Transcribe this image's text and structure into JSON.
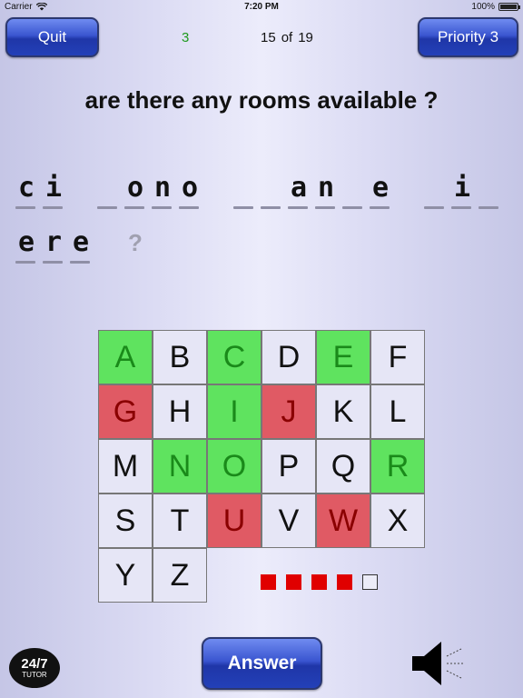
{
  "status_bar": {
    "carrier": "Carrier",
    "time": "7:20 PM",
    "battery": "100%",
    "battery_level": 1.0
  },
  "toolbar": {
    "quit_label": "Quit",
    "priority_label": "Priority 3"
  },
  "score": "3",
  "progress": {
    "current": "15",
    "of": "of",
    "total": "19"
  },
  "question": "are there any rooms available ?",
  "puzzle": {
    "lines": [
      [
        "c",
        "i",
        " ",
        "",
        "o",
        "n",
        "o",
        " ",
        "",
        "",
        "a",
        "n",
        "",
        "e",
        " ",
        "",
        "i",
        ""
      ],
      [
        "e",
        "r",
        "e"
      ]
    ],
    "end_mark": "?"
  },
  "letters": [
    {
      "l": "A",
      "s": "correct"
    },
    {
      "l": "B",
      "s": "unused"
    },
    {
      "l": "C",
      "s": "correct"
    },
    {
      "l": "D",
      "s": "unused"
    },
    {
      "l": "E",
      "s": "correct"
    },
    {
      "l": "F",
      "s": "unused"
    },
    {
      "l": "G",
      "s": "wrong"
    },
    {
      "l": "H",
      "s": "unused"
    },
    {
      "l": "I",
      "s": "correct"
    },
    {
      "l": "J",
      "s": "wrong"
    },
    {
      "l": "K",
      "s": "unused"
    },
    {
      "l": "L",
      "s": "unused"
    },
    {
      "l": "M",
      "s": "unused"
    },
    {
      "l": "N",
      "s": "correct"
    },
    {
      "l": "O",
      "s": "correct"
    },
    {
      "l": "P",
      "s": "unused"
    },
    {
      "l": "Q",
      "s": "unused"
    },
    {
      "l": "R",
      "s": "correct"
    },
    {
      "l": "S",
      "s": "unused"
    },
    {
      "l": "T",
      "s": "unused"
    },
    {
      "l": "U",
      "s": "wrong"
    },
    {
      "l": "V",
      "s": "unused"
    },
    {
      "l": "W",
      "s": "wrong"
    },
    {
      "l": "X",
      "s": "unused"
    },
    {
      "l": "Y",
      "s": "unused"
    },
    {
      "l": "Z",
      "s": "unused"
    }
  ],
  "lives": {
    "used": 4,
    "total": 5
  },
  "answer_label": "Answer",
  "logo": {
    "line1": "24/7",
    "line2": "TUTOR"
  },
  "icons": {
    "speaker": "speaker-icon",
    "wifi": "wifi-icon"
  },
  "colors": {
    "correct": "#5fe35f",
    "wrong": "#e05a64",
    "button": "#2340b8",
    "score": "#1e9a1e"
  }
}
